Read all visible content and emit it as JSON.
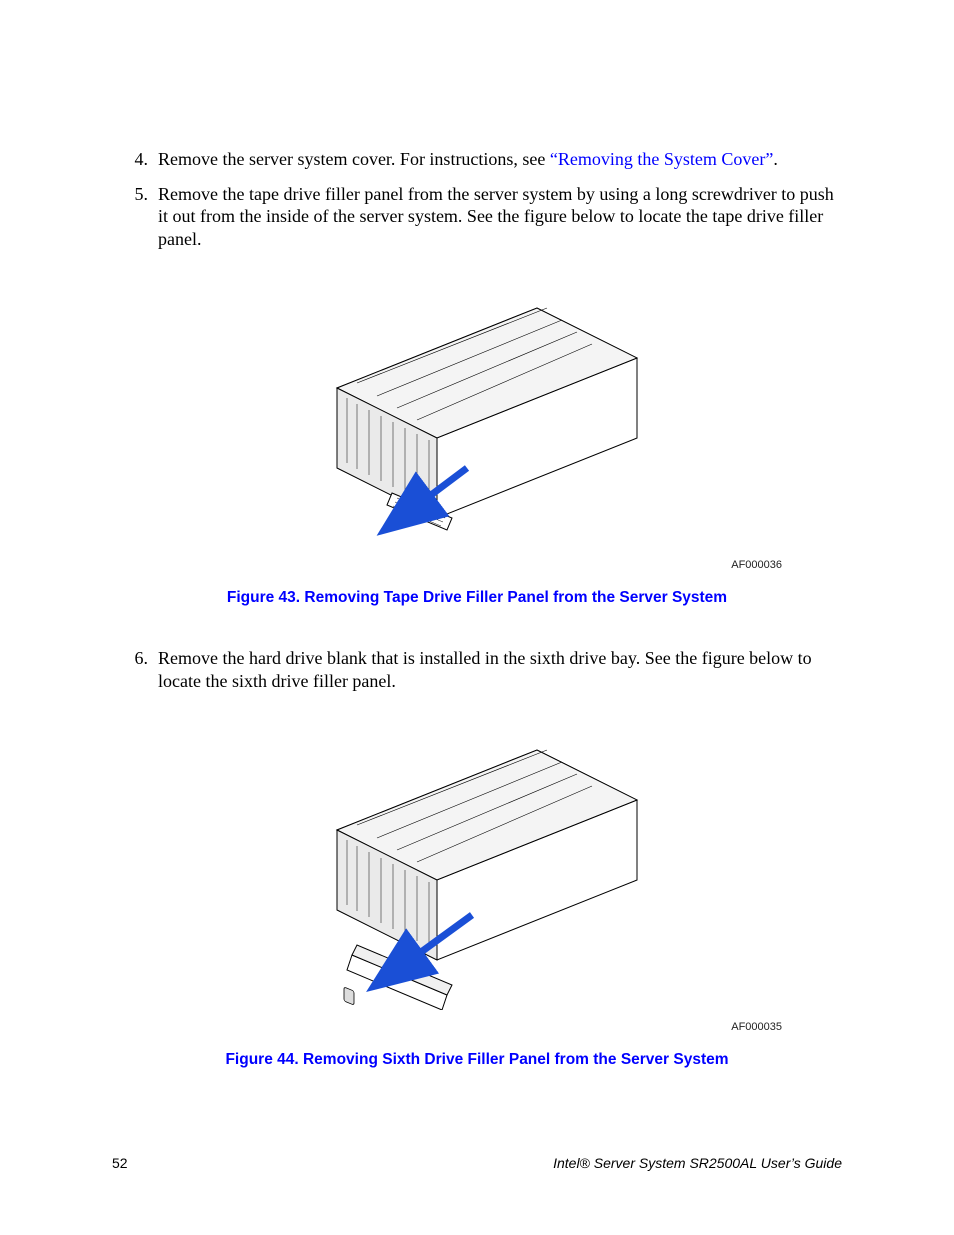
{
  "steps": [
    {
      "num": "4.",
      "pre": "Remove the server system cover. For instructions, see ",
      "link": "“Removing the System Cover”",
      "post": "."
    },
    {
      "num": "5.",
      "text": "Remove the tape drive filler panel from the server system by using a long screwdriver to push it out from the inside of the server system. See the figure below to locate the tape drive filler panel."
    },
    {
      "num": "6.",
      "text": "Remove the hard drive blank that is installed in the sixth drive bay. See the figure below to locate the sixth drive filler panel."
    }
  ],
  "figures": [
    {
      "af": "AF000036",
      "caption": "Figure 43. Removing Tape Drive Filler Panel from the Server System"
    },
    {
      "af": "AF000035",
      "caption": "Figure 44. Removing Sixth Drive Filler Panel from the Server System"
    }
  ],
  "footer": {
    "page": "52",
    "guide": "Intel® Server System SR2500AL User’s Guide"
  }
}
